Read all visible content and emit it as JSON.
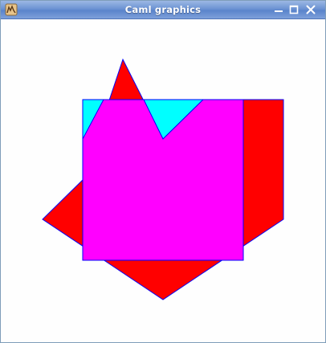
{
  "window": {
    "title": "Caml graphics",
    "app_icon": "caml-camel-icon",
    "buttons": [
      {
        "name": "minimize",
        "icon": "minimize-icon"
      },
      {
        "name": "maximize",
        "icon": "maximize-icon"
      },
      {
        "name": "close",
        "icon": "close-icon"
      }
    ]
  },
  "drawing": {
    "shapes": [
      {
        "name": "cyan-square",
        "fill": "#00ffff",
        "stroke": "#0000ff"
      },
      {
        "name": "red-polygon",
        "fill": "#ff0000",
        "stroke": "#0000ff"
      },
      {
        "name": "magenta-intersection",
        "fill": "#ff00ff",
        "stroke": "#0000ff"
      }
    ]
  }
}
